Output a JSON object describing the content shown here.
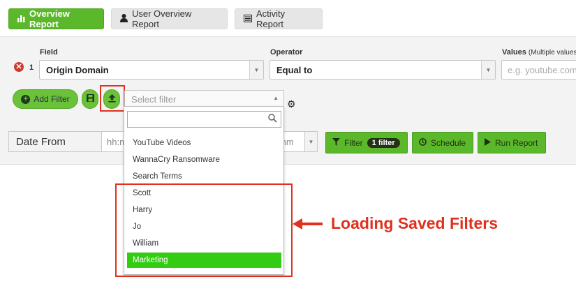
{
  "tabs": [
    {
      "label": "Overview Report",
      "icon": "bar-chart-icon",
      "active": true
    },
    {
      "label": "User Overview Report",
      "icon": "user-icon",
      "active": false
    },
    {
      "label": "Activity Report",
      "icon": "list-icon",
      "active": false
    }
  ],
  "filter": {
    "field_label": "Field",
    "operator_label": "Operator",
    "values_label": "Values",
    "values_hint": "(Multiple values",
    "row_number": "1",
    "field_value": "Origin Domain",
    "operator_value": "Equal to",
    "values_placeholder": "e.g. youtube.com"
  },
  "toolbar": {
    "add_filter_label": "Add Filter",
    "select_placeholder": "Select filter"
  },
  "date": {
    "label": "Date From",
    "time_placeholder": "hh:mm",
    "time_value_right": "mm"
  },
  "actions": {
    "filter_label": "Filter",
    "filter_badge": "1 filter",
    "schedule_label": "Schedule",
    "run_label": "Run Report"
  },
  "dropdown": {
    "items": [
      "YouTube Videos",
      "WannaCry Ransomware",
      "Search Terms",
      "Scott",
      "Harry",
      "Jo",
      "William",
      "Marketing"
    ],
    "selected": "Marketing"
  },
  "annotation": {
    "callout": "Loading Saved Filters"
  },
  "colors": {
    "accent_green": "#5cb82b",
    "annotation_red": "#e0311f",
    "selected_green": "#33cc12"
  }
}
